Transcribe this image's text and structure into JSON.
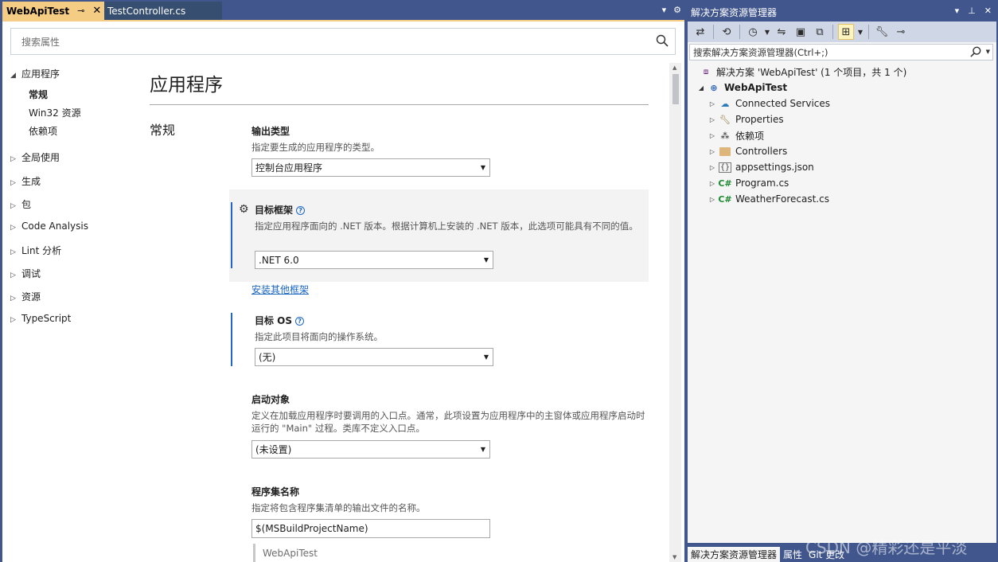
{
  "tabs": {
    "active": "WebApiTest",
    "inactive": "TestController.cs"
  },
  "properties": {
    "search_placeholder": "搜索属性",
    "nav": {
      "application": "应用程序",
      "sub": [
        "常规",
        "Win32 资源",
        "依赖项"
      ],
      "items": [
        "全局使用",
        "生成",
        "包",
        "Code Analysis",
        "Lint 分析",
        "调试",
        "资源",
        "TypeScript"
      ]
    },
    "heading": "应用程序",
    "section": "常规",
    "output_type": {
      "label": "输出类型",
      "desc": "指定要生成的应用程序的类型。",
      "value": "控制台应用程序"
    },
    "target_framework": {
      "label": "目标框架",
      "desc": "指定应用程序面向的 .NET 版本。根据计算机上安装的 .NET 版本，此选项可能具有不同的值。",
      "value": ".NET 6.0",
      "link": "安装其他框架"
    },
    "target_os": {
      "label": "目标 OS",
      "desc": "指定此项目将面向的操作系统。",
      "value": "(无)"
    },
    "startup_object": {
      "label": "启动对象",
      "desc": "定义在加载应用程序时要调用的入口点。通常，此项设置为应用程序中的主窗体或应用程序启动时运行的 \"Main\" 过程。类库不定义入口点。",
      "value": "(未设置)"
    },
    "assembly_name": {
      "label": "程序集名称",
      "desc": "指定将包含程序集清单的输出文件的名称。",
      "value": "$(MSBuildProjectName)",
      "preview": "WebApiTest"
    }
  },
  "solution_explorer": {
    "title": "解决方案资源管理器",
    "search_placeholder": "搜索解决方案资源管理器(Ctrl+;)",
    "solution": "解决方案 'WebApiTest' (1 个项目，共 1 个)",
    "project": "WebApiTest",
    "items": [
      "Connected Services",
      "Properties",
      "依赖项",
      "Controllers",
      "appsettings.json",
      "Program.cs",
      "WeatherForecast.cs"
    ],
    "bottom_tabs": [
      "解决方案资源管理器",
      "属性",
      "Git 更改"
    ]
  },
  "watermark": "CSDN @精彩还是平淡"
}
